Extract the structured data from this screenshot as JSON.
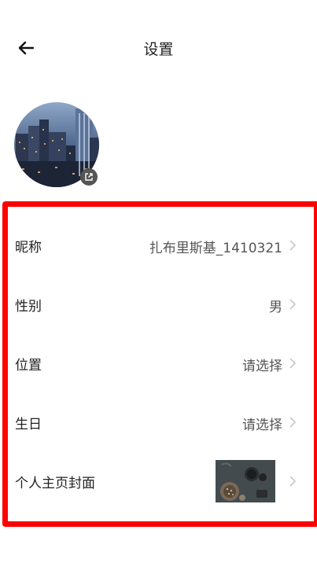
{
  "header": {
    "title": "设置",
    "back_icon": "arrow-left-icon"
  },
  "profile": {
    "avatar_icon": "city-skyline-avatar",
    "edit_icon": "external-edit-icon"
  },
  "colors": {
    "highlight": "#ff0000",
    "label": "#222222",
    "value": "#555555",
    "chevron": "#c8c8c8"
  },
  "settings": [
    {
      "label": "昵称",
      "value": "扎布里斯基_1410321"
    },
    {
      "label": "性别",
      "value": "男"
    },
    {
      "label": "位置",
      "value": "请选择"
    },
    {
      "label": "生日",
      "value": "请选择"
    },
    {
      "label": "个人主页封面",
      "value": ""
    }
  ]
}
